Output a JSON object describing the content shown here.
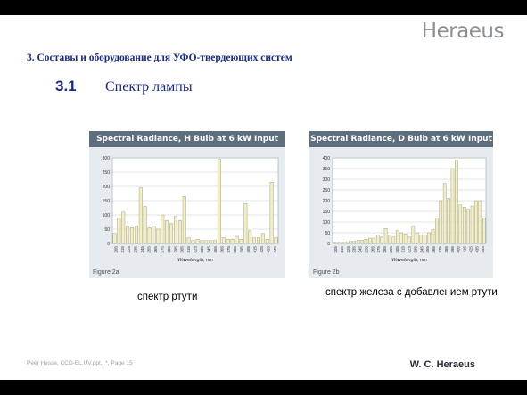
{
  "brand": "Heraeus",
  "subtitle": "3. Составы и оборудование для УФО-твердеющих систем",
  "section": {
    "number": "3.1",
    "title": "Спектр лампы"
  },
  "captions": {
    "left": "спектр ртути",
    "right": "спектр железа с добавлением ртути"
  },
  "footer": {
    "left": "Peer Hesse, CCD-EL,UV.ppt,, *, Page 15",
    "right": "W. C. Heraeus"
  },
  "colors": {
    "bar": "#f3efc4",
    "bar_stroke": "#8e8c74",
    "header": "#5d6f7f",
    "panel": "#e6ebef",
    "text_blue": "#1a2a80"
  },
  "chart_data": [
    {
      "type": "bar",
      "title": "Spectral Radiance, H Bulb at 6 kW Input",
      "xlabel": "Wavelength, nm",
      "ylabel": "",
      "figure_label": "Figure 2a",
      "ylim": [
        0,
        300
      ],
      "yticks": [
        0,
        50,
        100,
        150,
        200,
        250,
        300
      ],
      "categories": [
        "205",
        "215",
        "225",
        "235",
        "245",
        "255",
        "265",
        "275",
        "285",
        "295",
        "305",
        "315",
        "325",
        "335",
        "345",
        "355",
        "365",
        "375",
        "385",
        "395",
        "405",
        "415",
        "425",
        "435",
        "445"
      ],
      "values": [
        35,
        90,
        110,
        60,
        55,
        60,
        195,
        130,
        55,
        60,
        50,
        100,
        80,
        70,
        95,
        80,
        165,
        20,
        10,
        15,
        10,
        10,
        10,
        10,
        295,
        20,
        15,
        15,
        25,
        15,
        140,
        45,
        20,
        20,
        35,
        15,
        215,
        20
      ],
      "grid": true
    },
    {
      "type": "bar",
      "title": "Spectral Radiance, D Bulb at 6 kW Input",
      "xlabel": "Wavelength, nm",
      "ylabel": "",
      "figure_label": "Figure 2b",
      "ylim": [
        0,
        400
      ],
      "yticks": [
        0,
        50,
        100,
        150,
        200,
        250,
        300,
        350,
        400
      ],
      "categories": [
        "205",
        "215",
        "225",
        "235",
        "245",
        "255",
        "265",
        "275",
        "285",
        "295",
        "305",
        "315",
        "325",
        "335",
        "345",
        "355",
        "365",
        "375",
        "385",
        "395",
        "405",
        "415",
        "425",
        "435",
        "445"
      ],
      "values": [
        5,
        5,
        5,
        5,
        10,
        10,
        15,
        15,
        20,
        25,
        25,
        40,
        30,
        70,
        40,
        30,
        60,
        50,
        45,
        30,
        80,
        50,
        40,
        40,
        50,
        65,
        120,
        200,
        280,
        210,
        350,
        390,
        180,
        170,
        160,
        175,
        200,
        200,
        120
      ],
      "grid": true
    }
  ]
}
